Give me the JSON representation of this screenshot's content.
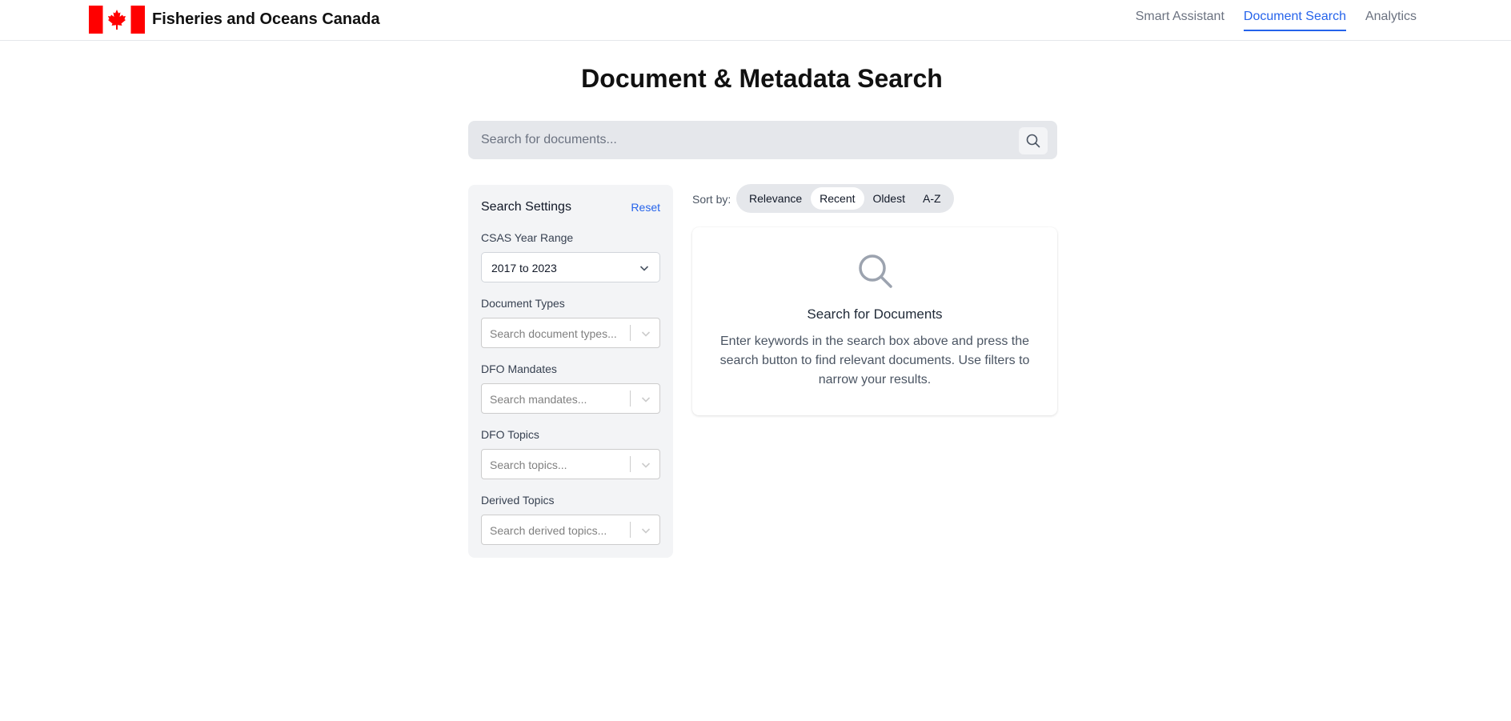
{
  "header": {
    "brand_name": "Fisheries and Oceans Canada",
    "logo_icon": "canada-flag-icon",
    "nav": [
      {
        "label": "Smart Assistant",
        "active": false
      },
      {
        "label": "Document Search",
        "active": true
      },
      {
        "label": "Analytics",
        "active": false
      }
    ],
    "accent_color": "#2563eb",
    "flag_color": "#ff0000"
  },
  "main": {
    "title": "Document & Metadata Search",
    "search": {
      "placeholder": "Search for documents...",
      "value": "",
      "icon": "search-icon"
    }
  },
  "settings": {
    "title": "Search Settings",
    "reset_label": "Reset",
    "year_range": {
      "label": "CSAS Year Range",
      "value": "2017 to 2023"
    },
    "document_types": {
      "label": "Document Types",
      "placeholder": "Search document types..."
    },
    "mandates": {
      "label": "DFO Mandates",
      "placeholder": "Search mandates..."
    },
    "topics": {
      "label": "DFO Topics",
      "placeholder": "Search topics..."
    },
    "derived_topics": {
      "label": "Derived Topics",
      "placeholder": "Search derived topics..."
    }
  },
  "sort": {
    "label": "Sort by:",
    "options": [
      "Relevance",
      "Recent",
      "Oldest",
      "A-Z"
    ],
    "selected": "Recent"
  },
  "empty_state": {
    "icon": "search-icon",
    "title": "Search for Documents",
    "text": "Enter keywords in the search box above and press the search button to find relevant documents. Use filters to narrow your results."
  }
}
